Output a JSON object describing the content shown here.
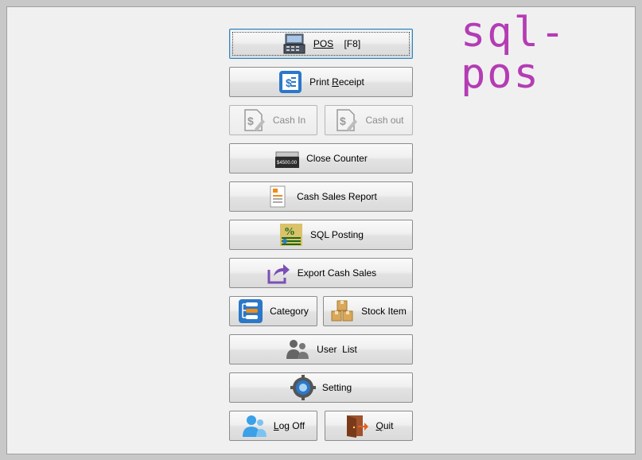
{
  "logo": "sql-pos",
  "buttons": {
    "pos": {
      "label": "POS",
      "shortcut": "[F8]"
    },
    "print_receipt": {
      "pre": "Print ",
      "u": "R",
      "post": "eceipt"
    },
    "cash_in": {
      "label": "Cash In"
    },
    "cash_out": {
      "label": "Cash out"
    },
    "close_counter": {
      "label": "Close Counter",
      "icon_text": "$4500.00"
    },
    "cash_sales_report": {
      "label": "Cash Sales Report"
    },
    "sql_posting": {
      "label": "SQL Posting"
    },
    "export_cash_sales": {
      "label": "Export Cash Sales"
    },
    "category": {
      "label": "Category"
    },
    "stock_item": {
      "label": "Stock Item"
    },
    "user_list": {
      "label": "User  List"
    },
    "setting": {
      "label": "Setting"
    },
    "log_off": {
      "u": "L",
      "post": "og Off"
    },
    "quit": {
      "u": "Q",
      "post": "uit"
    }
  },
  "colors": {
    "logo": "#b43cb4",
    "accent_blue": "#2b78c8",
    "gray_icon": "#8a8a8a"
  }
}
